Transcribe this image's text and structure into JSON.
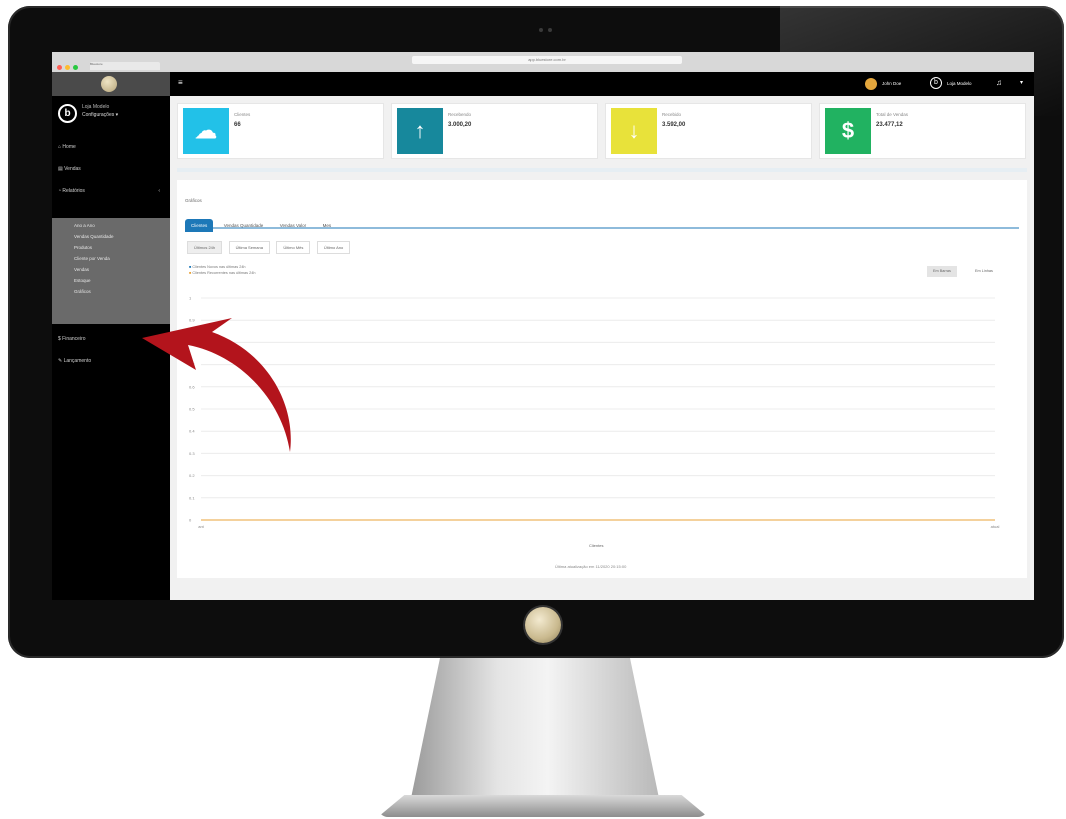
{
  "browser": {
    "tab_label": "Bluestore",
    "url": "app.bluestore.com.br"
  },
  "sidebar": {
    "brand_line1": "Loja Modelo",
    "brand_line2": "Configurações ▾",
    "items": [
      {
        "label": "Home"
      },
      {
        "label": "Vendas"
      },
      {
        "label": "Relatórios"
      }
    ],
    "subitems": [
      "Ano a Ano",
      "Vendas Quantidade",
      "Produtos",
      "Cliente por Venda",
      "Vendas",
      "Estoque",
      "Gráficos"
    ],
    "bottom_items": [
      {
        "label": "Financeiro"
      },
      {
        "label": "Lançamento"
      }
    ]
  },
  "topbar": {
    "menu_icon": "hamburger-icon",
    "user_name": "John Doe",
    "store_name": "Loja Modelo"
  },
  "cards": [
    {
      "label": "Clientes",
      "value": "66",
      "icon": "cloud-icon",
      "color": "#22c1e8"
    },
    {
      "label": "Recebendo",
      "value": "3.000,20",
      "icon": "arrow-up-icon",
      "color": "#17889c"
    },
    {
      "label": "Recebido",
      "value": "3.592,00",
      "icon": "arrow-down-icon",
      "color": "#e8e23a"
    },
    {
      "label": "Total de Vendas",
      "value": "23.477,12",
      "icon": "dollar-icon",
      "color": "#21b261"
    }
  ],
  "panel": {
    "title": "Gráficos",
    "tabs": [
      "Clientes",
      "Vendas Quantidade",
      "Vendas Valor",
      "Mes"
    ],
    "subtabs": [
      "Últimos 24h",
      "Última Semana",
      "Último Mês",
      "Último Ano"
    ],
    "legend": [
      "Clientes Novos nas últimas 24h",
      "Clientes Recorrentes nas últimas 24h"
    ],
    "right_buttons": [
      "Em Barras",
      "Em Linhas"
    ],
    "xlabel": "Clientes",
    "footer": "Última atualização em 11/2020 20:15:00"
  },
  "chart_data": {
    "type": "line",
    "series": [
      {
        "name": "Clientes Novos nas últimas 24h",
        "values": [
          0,
          0
        ]
      },
      {
        "name": "Clientes Recorrentes nas últimas 24h",
        "values": [
          0,
          0
        ]
      }
    ],
    "yticks": [
      "1",
      "0.9",
      "0.8",
      "0.7",
      "0.6",
      "0.5",
      "0.4",
      "0.3",
      "0.2",
      "0.1",
      "0"
    ],
    "xticks": [
      "ant",
      "atual"
    ],
    "xlabel": "Clientes",
    "ylim": [
      0,
      1
    ],
    "grid": true
  },
  "annotation": {
    "arrow_color": "#b3141c"
  }
}
